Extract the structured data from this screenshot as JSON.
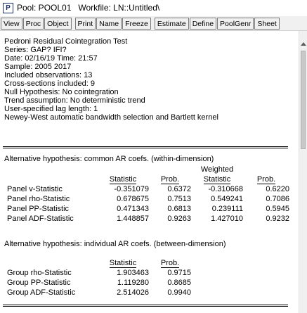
{
  "window": {
    "icon_letter": "P",
    "title": "Pool: POOL01   Workfile: LN::Untitled\\"
  },
  "toolbar": {
    "buttons": [
      "View",
      "Proc",
      "Object",
      "Print",
      "Name",
      "Freeze",
      "Estimate",
      "Define",
      "PoolGenr",
      "Sheet"
    ]
  },
  "header": {
    "lines": [
      "Pedroni Residual Cointegration Test",
      "Series: GAP? IFI?",
      "Date: 02/16/19   Time: 21:57",
      "Sample: 2005 2017",
      "Included observations: 13",
      "Cross-sections included: 9",
      "Null Hypothesis: No cointegration",
      "Trend assumption: No deterministic trend",
      "User-specified lag length: 1",
      "Newey-West automatic bandwidth selection and Bartlett kernel"
    ]
  },
  "within": {
    "title": "Alternative hypothesis: common AR coefs. (within-dimension)",
    "weighted_label": "Weighted",
    "columns": [
      "Statistic",
      "Prob.",
      "Statistic",
      "Prob."
    ],
    "rows": [
      {
        "label": "Panel v-Statistic",
        "stat": "-0.351079",
        "prob": "0.6372",
        "wstat": "-0.310668",
        "wprob": "0.6220"
      },
      {
        "label": "Panel rho-Statistic",
        "stat": "0.678675",
        "prob": "0.7513",
        "wstat": "0.549241",
        "wprob": "0.7086"
      },
      {
        "label": "Panel PP-Statistic",
        "stat": "0.471343",
        "prob": "0.6813",
        "wstat": "0.239111",
        "wprob": "0.5945"
      },
      {
        "label": "Panel ADF-Statistic",
        "stat": "1.448857",
        "prob": "0.9263",
        "wstat": "1.427010",
        "wprob": "0.9232"
      }
    ]
  },
  "between": {
    "title": "Alternative hypothesis: individual AR coefs. (between-dimension)",
    "columns": [
      "Statistic",
      "Prob."
    ],
    "rows": [
      {
        "label": "Group rho-Statistic",
        "stat": "1.903463",
        "prob": "0.9715"
      },
      {
        "label": "Group PP-Statistic",
        "stat": "1.119280",
        "prob": "0.8685"
      },
      {
        "label": "Group ADF-Statistic",
        "stat": "2.514026",
        "prob": "0.9940"
      }
    ]
  }
}
